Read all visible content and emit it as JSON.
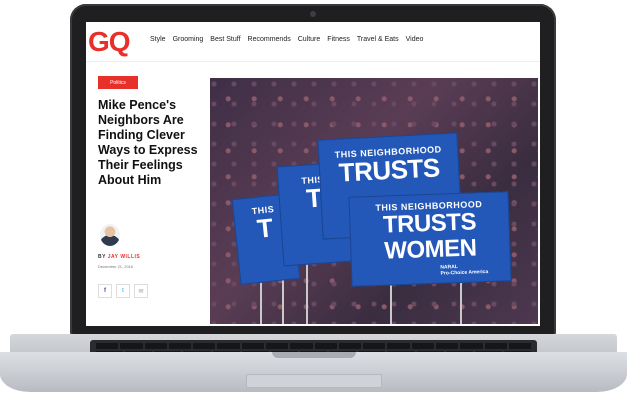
{
  "site": {
    "logo": "GQ",
    "nav": [
      "Style",
      "Grooming",
      "Best Stuff",
      "Recommends",
      "Culture",
      "Fitness",
      "Travel & Eats",
      "Video"
    ]
  },
  "article": {
    "category": "Politics",
    "headline": "Mike Pence's Neighbors Are Finding Clever Ways to Express Their Feelings About Him",
    "byline_prefix": "BY",
    "author": "JAY WILLIS",
    "date": "December 21, 2016"
  },
  "share": {
    "facebook": "f",
    "twitter": "t",
    "email": "✉"
  },
  "hero_signs": {
    "line1": "THIS NEIGHBORHOOD",
    "line2": "TRUSTS",
    "line3": "WOMEN",
    "org": "NARAL",
    "org_sub": "Pro-Choice America",
    "partial_back": "TRUSTS",
    "partial_left": "THIS",
    "partial_left_big": "T"
  },
  "colors": {
    "brand": "#e8302b",
    "sign_blue": "#2358b8"
  }
}
